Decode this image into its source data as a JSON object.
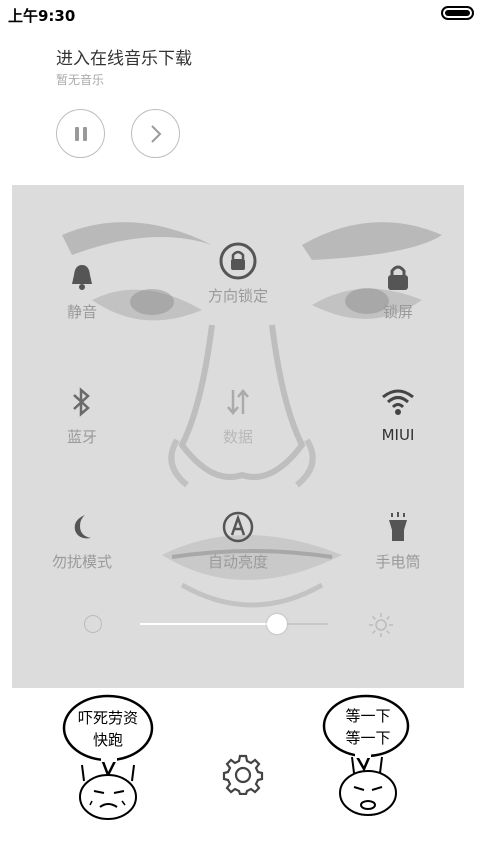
{
  "status_bar": {
    "time": "上午9:30",
    "battery_level": 1.0
  },
  "music": {
    "title": "进入在线音乐下载",
    "subtitle": "暂无音乐",
    "pause_icon": "pause-icon",
    "next_icon": "chevron-right-icon"
  },
  "toggles": [
    {
      "label": "静音",
      "icon": "bell-icon",
      "style": "gray"
    },
    {
      "label": "方向锁定",
      "icon": "rotation-lock-icon",
      "style": "gray"
    },
    {
      "label": "锁屏",
      "icon": "padlock-icon",
      "style": "gray"
    },
    {
      "label": "蓝牙",
      "icon": "bluetooth-icon",
      "style": "gray"
    },
    {
      "label": "数据",
      "icon": "data-arrows-icon",
      "style": "faint"
    },
    {
      "label": "MIUI",
      "icon": "wifi-icon",
      "style": "active"
    },
    {
      "label": "勿扰模式",
      "icon": "moon-icon",
      "style": "gray"
    },
    {
      "label": "自动亮度",
      "icon": "auto-brightness-icon",
      "style": "gray"
    },
    {
      "label": "手电筒",
      "icon": "flashlight-icon",
      "style": "gray"
    }
  ],
  "brightness": {
    "level": 0.73,
    "low_icon": "brightness-low-icon",
    "high_icon": "brightness-high-icon"
  },
  "bottom": {
    "left_meme_text": [
      "吓死劳资",
      "快跑"
    ],
    "right_meme_text": [
      "等一下",
      "等一下"
    ],
    "settings_icon": "gear-icon"
  },
  "colors": {
    "panel_bg": "#dcdcdc",
    "label_gray": "#9a9a9a",
    "label_active": "#333333",
    "icon_dark": "#555555"
  }
}
